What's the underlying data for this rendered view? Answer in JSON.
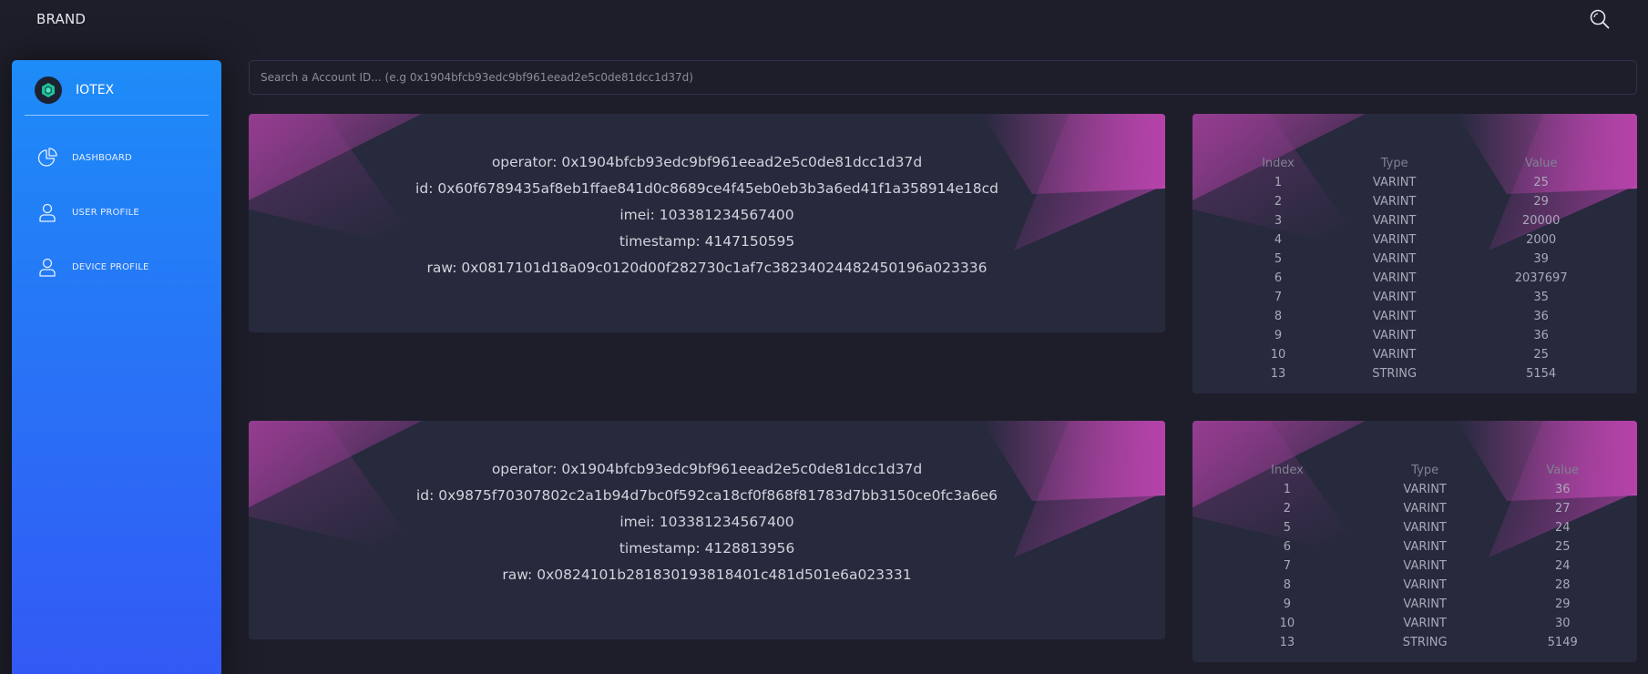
{
  "app": {
    "brand": "BRAND"
  },
  "sidebar": {
    "logo_text": "IOTEX",
    "items": [
      {
        "label": "DASHBOARD",
        "icon": "pie-chart-icon"
      },
      {
        "label": "USER PROFILE",
        "icon": "user-icon"
      },
      {
        "label": "DEVICE PROFILE",
        "icon": "user-icon"
      }
    ]
  },
  "search": {
    "placeholder": "Search a Account ID... (e.g 0x1904bfcb93edc9bf961eead2e5c0de81dcc1d37d)"
  },
  "records": [
    {
      "lines": [
        "operator: 0x1904bfcb93edc9bf961eead2e5c0de81dcc1d37d",
        "id: 0x60f6789435af8eb1ffae841d0c8689ce4f45eb0eb3b3a6ed41f1a358914e18cd",
        "imei: 103381234567400",
        "timestamp: 4147150595",
        "raw: 0x0817101d18a09c0120d00f282730c1af7c38234024482450196a023336"
      ],
      "table": {
        "headers": [
          "Index",
          "Type",
          "Value"
        ],
        "rows": [
          [
            "1",
            "VARINT",
            "25"
          ],
          [
            "2",
            "VARINT",
            "29"
          ],
          [
            "3",
            "VARINT",
            "20000"
          ],
          [
            "4",
            "VARINT",
            "2000"
          ],
          [
            "5",
            "VARINT",
            "39"
          ],
          [
            "6",
            "VARINT",
            "2037697"
          ],
          [
            "7",
            "VARINT",
            "35"
          ],
          [
            "8",
            "VARINT",
            "36"
          ],
          [
            "9",
            "VARINT",
            "36"
          ],
          [
            "10",
            "VARINT",
            "25"
          ],
          [
            "13",
            "STRING",
            "5154"
          ]
        ]
      }
    },
    {
      "lines": [
        "operator: 0x1904bfcb93edc9bf961eead2e5c0de81dcc1d37d",
        "id: 0x9875f70307802c2a1b94d7bc0f592ca18cf0f868f81783d7bb3150ce0fc3a6e6",
        "imei: 103381234567400",
        "timestamp: 4128813956",
        "raw: 0x0824101b281830193818401c481d501e6a023331"
      ],
      "table": {
        "headers": [
          "Index",
          "Type",
          "Value"
        ],
        "rows": [
          [
            "1",
            "VARINT",
            "36"
          ],
          [
            "2",
            "VARINT",
            "27"
          ],
          [
            "5",
            "VARINT",
            "24"
          ],
          [
            "6",
            "VARINT",
            "25"
          ],
          [
            "7",
            "VARINT",
            "24"
          ],
          [
            "8",
            "VARINT",
            "28"
          ],
          [
            "9",
            "VARINT",
            "29"
          ],
          [
            "10",
            "VARINT",
            "30"
          ],
          [
            "13",
            "STRING",
            "5149"
          ]
        ]
      }
    }
  ],
  "colors": {
    "background": "#1e1e2b",
    "card": "#27293d",
    "sidebar_top": "#1d8cf8",
    "sidebar_bottom": "#3358f4",
    "accent_pink": "#c847b8"
  }
}
